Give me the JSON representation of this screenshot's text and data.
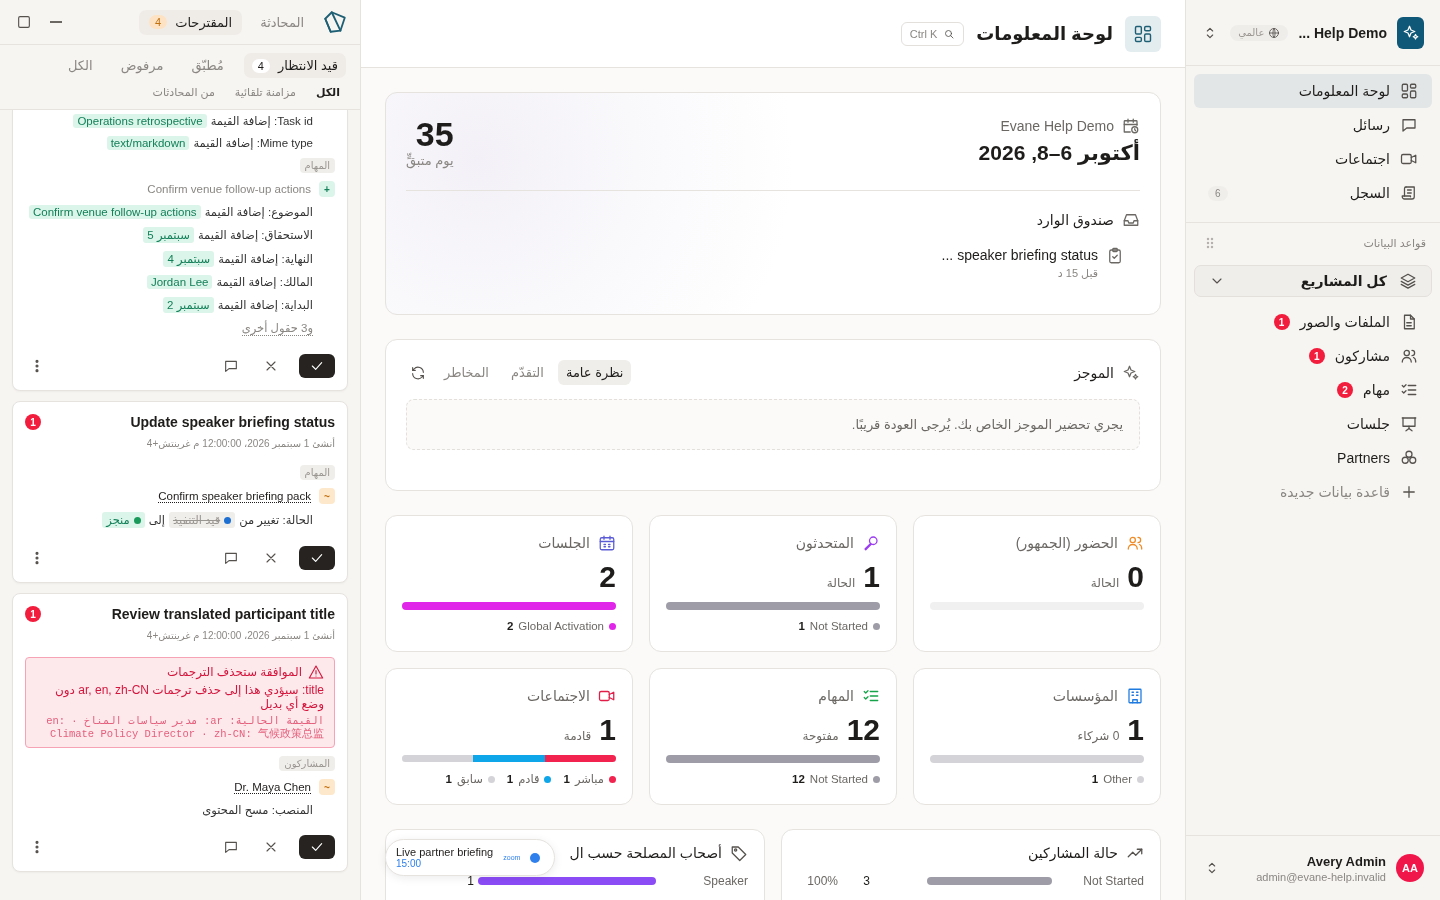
{
  "sidebar": {
    "workspace": {
      "name": "Help Demo ...",
      "scope": "عالمي"
    },
    "nav": [
      {
        "label": "لوحة المعلومات",
        "selected": true
      },
      {
        "label": "رسائل",
        "selected": false
      },
      {
        "label": "اجتماعات",
        "selected": false
      },
      {
        "label": "السجل",
        "selected": false,
        "count": "6"
      }
    ],
    "databases": {
      "title": "قواعد البيانات",
      "project": "كل المشاريع",
      "items": [
        {
          "label": "الملفات والصور",
          "badge": "1"
        },
        {
          "label": "مشاركون",
          "badge": "1"
        },
        {
          "label": "مهام",
          "badge": "2"
        },
        {
          "label": "جلسات"
        },
        {
          "label": "Partners"
        }
      ],
      "add": "قاعدة بيانات جديدة"
    },
    "user": {
      "name": "Avery Admin",
      "email": "admin@evane-help.invalid",
      "initials": "AA"
    }
  },
  "main": {
    "header": {
      "title": "لوحة المعلومات",
      "search_shortcut": "Ctrl K"
    },
    "event": {
      "org": "Evane Help Demo",
      "dates": "أكتوبر 6–8, 2026",
      "countdown": "35",
      "countdown_label": "يوم متبقٍّ",
      "inbox": {
        "title": "صندوق الوارد",
        "items": [
          {
            "title": "speaker briefing status ...",
            "time": "قبل 15 د"
          }
        ]
      }
    },
    "briefing": {
      "title": "الموجز",
      "tabs": [
        {
          "label": "نظرة عامة",
          "selected": true
        },
        {
          "label": "التقدّم",
          "selected": false
        },
        {
          "label": "المخاطر",
          "selected": false
        }
      ],
      "message": "يجري تحضير الموجز الخاص بك. يُرجى العودة قريبًا."
    },
    "stats": [
      {
        "label": "الحضور (الجمهور)",
        "value": "0",
        "sub": "الحالة"
      },
      {
        "label": "المتحدثون",
        "value": "1",
        "sub": "الحالة",
        "legend": [
          {
            "label": "Not Started",
            "count": "1",
            "color": "#9e9ca6"
          }
        ]
      },
      {
        "label": "الجلسات",
        "value": "2",
        "legend": [
          {
            "label": "Global Activation",
            "count": "2",
            "color": "#e026e8"
          }
        ]
      },
      {
        "label": "المؤسسات",
        "value": "1",
        "sub": "0 شركاء",
        "legend": [
          {
            "label": "Other",
            "count": "1",
            "color": "#d4d4d8"
          }
        ]
      },
      {
        "label": "المهام",
        "value": "12",
        "sub": "مفتوحة",
        "legend": [
          {
            "label": "Not Started",
            "count": "12",
            "color": "#9e9ca6"
          }
        ]
      },
      {
        "label": "الاجتماعات",
        "value": "1",
        "sub": "قادمة",
        "legend": [
          {
            "label": "مباشر",
            "count": "1",
            "color": "#f2234f"
          },
          {
            "label": "قادم",
            "count": "1",
            "color": "#0ea5e9"
          },
          {
            "label": "سابق",
            "count": "1",
            "color": "#d4d4d8"
          }
        ]
      }
    ],
    "charts": [
      {
        "title": "حالة المشاركين",
        "rows": [
          {
            "label": "Not Started",
            "count": "3",
            "percent": "100%",
            "color": "#9e9ca6"
          }
        ]
      },
      {
        "title": "أصحاب المصلحة حسب ال",
        "rows": [
          {
            "label": "Speaker",
            "count": "1",
            "color": "#8b4cf6"
          }
        ]
      }
    ],
    "meeting_popup": {
      "title": "Live partner briefing",
      "time": "15:00",
      "provider": "zoom"
    }
  },
  "left_panel": {
    "tabs": [
      {
        "label": "المحادثة",
        "selected": false
      },
      {
        "label": "المقترحات",
        "selected": true,
        "count": "4"
      }
    ],
    "status_filters": [
      {
        "label": "قيد الانتظار",
        "count": "4",
        "selected": true
      },
      {
        "label": "مُطبّق",
        "selected": false
      },
      {
        "label": "مرفوض",
        "selected": false
      },
      {
        "label": "الكل",
        "selected": false
      }
    ],
    "source_filters": [
      {
        "label": "الكل",
        "selected": true
      },
      {
        "label": "مزامنة تلقائية",
        "selected": false
      },
      {
        "label": "من المحادثات",
        "selected": false
      }
    ],
    "cards": [
      {
        "blocks": [
          {
            "kind": "field",
            "label": "Task id:",
            "action": "إضافة القيمة",
            "value": "Operations retrospective"
          },
          {
            "kind": "field",
            "label": "Mime type:",
            "action": "إضافة القيمة",
            "value": "text/markdown"
          },
          {
            "kind": "section",
            "label": "المهام"
          },
          {
            "kind": "item_added",
            "marker": "+",
            "text": "Confirm venue follow-up actions"
          },
          {
            "kind": "field",
            "label": "الموضوع:",
            "action": "إضافة القيمة",
            "value": "Confirm venue follow-up actions"
          },
          {
            "kind": "field",
            "label": "الاستحقاق:",
            "action": "إضافة القيمة",
            "value": "سبتمبر 5"
          },
          {
            "kind": "field",
            "label": "النهاية:",
            "action": "إضافة القيمة",
            "value": "سبتمبر 4"
          },
          {
            "kind": "field",
            "label": "المالك:",
            "action": "إضافة القيمة",
            "value": "Jordan Lee"
          },
          {
            "kind": "field",
            "label": "البداية:",
            "action": "إضافة القيمة",
            "value": "سبتمبر 2"
          },
          {
            "kind": "more",
            "text": "و3 حقول أخرى"
          }
        ]
      },
      {
        "title": "Update speaker briefing status",
        "meta": "أنشئ 1 سبتمبر 2026، 12:00:00 م غرينتش+4",
        "badge": "1",
        "blocks": [
          {
            "kind": "section",
            "label": "المهام"
          },
          {
            "kind": "item_changed",
            "marker": "~",
            "text": "Confirm speaker briefing pack"
          },
          {
            "kind": "status",
            "label": "الحالة: تغيير من",
            "from": {
              "text": "قيد التنفيذ",
              "color": "#1d6fd1"
            },
            "joiner": "إلى",
            "to": {
              "text": "منجز",
              "color": "#1a9a5a"
            }
          }
        ]
      },
      {
        "title": "Review translated participant title",
        "meta": "أنشئ 1 سبتمبر 2026، 12:00:00 م غرينتش+4",
        "badge": "1",
        "blocks": [
          {
            "kind": "warning",
            "title": "الموافقة ستحذف الترجمات",
            "body": "title: سيؤدي هذا إلى حذف ترجمات ar, en, zh-CN دون وضع أي بديل",
            "detail": "القيمة الحالية: ar: مدير سياسات المناخ · en: Climate Policy Director · zh-CN: 气候政策总监"
          },
          {
            "kind": "section",
            "label": "المشاركون"
          },
          {
            "kind": "item_changed",
            "marker": "~",
            "text": "Dr. Maya Chen"
          },
          {
            "kind": "text",
            "text": "المنصب: مسح المحتوى"
          }
        ]
      }
    ]
  }
}
